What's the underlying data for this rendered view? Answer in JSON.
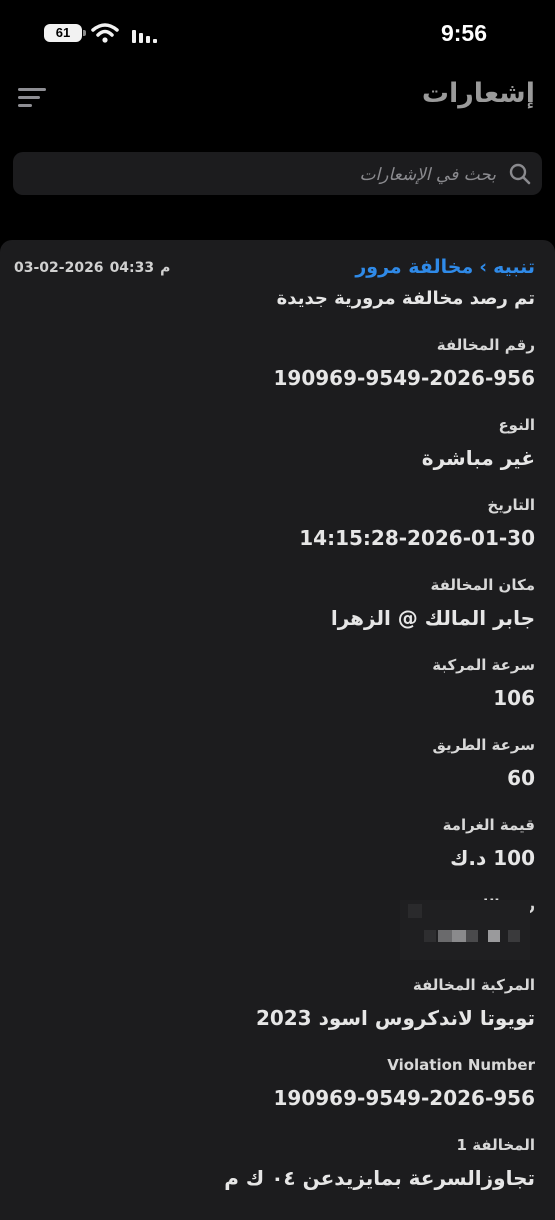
{
  "status_bar": {
    "battery": "61",
    "time": "9:56"
  },
  "header": {
    "title": "إشعارات"
  },
  "search": {
    "placeholder": "بحث في الإشعارات"
  },
  "notification": {
    "category": "تنبيه",
    "separator": "›",
    "type": "مخالفة مرور",
    "time": "04:33",
    "meridiem": "م",
    "date": "03-02-2026",
    "message": "تم رصد مخالفة مرورية جديدة",
    "fields": [
      {
        "label": "رقم المخالفة",
        "value": "190969-9549-2026-956"
      },
      {
        "label": "النوع",
        "value": "غير مباشرة"
      },
      {
        "label": "التاريخ",
        "value": "14:15:28-2026-01-30"
      },
      {
        "label": "مكان المخالفة",
        "value": "جابر المالك @ الزهرا"
      },
      {
        "label": "سرعة المركبة",
        "value": "106"
      },
      {
        "label": "سرعة الطريق",
        "value": "60"
      },
      {
        "label": "قيمة الغرامة",
        "value": "100 د.ك"
      },
      {
        "label": "رقم اللوحة",
        "value": ""
      },
      {
        "label": "المركبة المخالفة",
        "value": "تويوتا لاندكروس اسود 2023"
      },
      {
        "label": "Violation Number",
        "value": "190969-9549-2026-956"
      },
      {
        "label": "المخالفة 1",
        "value": "تجاوزالسرعة بمايزيدعن ٠٤ ك م"
      }
    ]
  }
}
